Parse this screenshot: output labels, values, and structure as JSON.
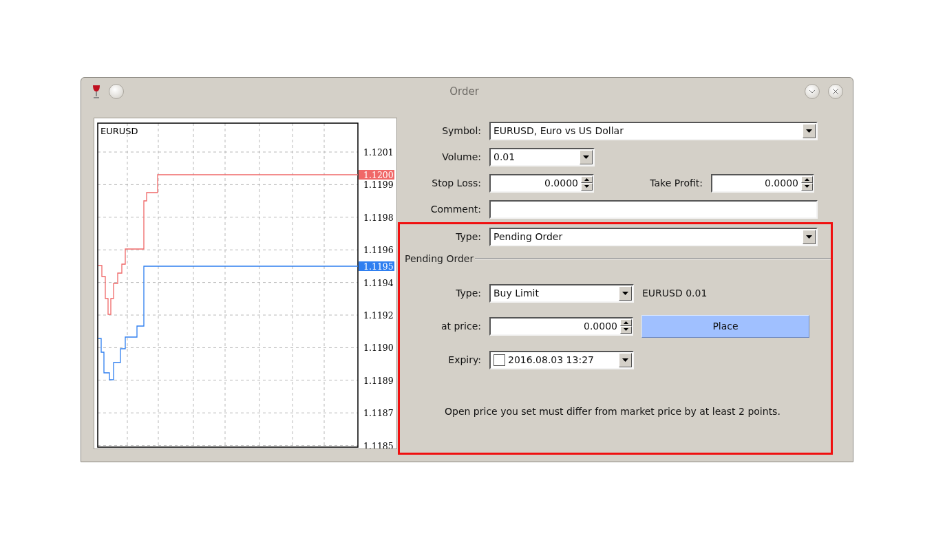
{
  "window": {
    "title": "Order"
  },
  "chart": {
    "symbol": "EURUSD",
    "price_scale": [
      "1.1201",
      "1.1199",
      "1.1198",
      "1.1196",
      "1.1194",
      "1.1192",
      "1.1190",
      "1.1189",
      "1.1187",
      "1.1185"
    ],
    "ask_tag": "1.1200",
    "bid_tag": "1.1195"
  },
  "form": {
    "symbol": {
      "label": "Symbol:",
      "value": "EURUSD, Euro vs US Dollar"
    },
    "volume": {
      "label": "Volume:",
      "value": "0.01"
    },
    "stop_loss": {
      "label": "Stop Loss:",
      "value": "0.0000"
    },
    "take_profit": {
      "label": "Take Profit:",
      "value": "0.0000"
    },
    "comment": {
      "label": "Comment:"
    },
    "type": {
      "label": "Type:",
      "value": "Pending Order"
    }
  },
  "pending_order": {
    "title": "Pending Order",
    "type": {
      "label": "Type:",
      "value": "Buy Limit"
    },
    "summary": "EURUSD 0.01",
    "price": {
      "label": "at price:",
      "value": "0.0000"
    },
    "place_button": "Place",
    "expiry": {
      "label": "Expiry:",
      "value": "2016.08.03 13:27",
      "checked": false
    },
    "note": "Open price you set must differ from market price by at least 2 points."
  }
}
